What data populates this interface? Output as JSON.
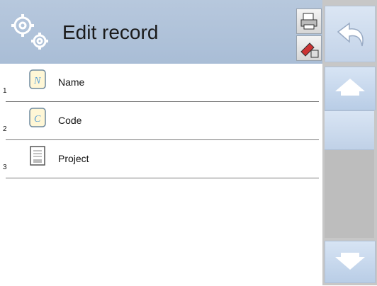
{
  "header": {
    "title": "Edit record",
    "gear_icon": "gears-icon",
    "print_icon": "printer-icon",
    "settings_icon": "settings-icon"
  },
  "nav": {
    "back_icon": "undo-arrow-icon",
    "up_icon": "arrow-up-icon",
    "down_icon": "arrow-down-icon"
  },
  "records": [
    {
      "number": "1",
      "label": "Name",
      "icon": "name-icon",
      "icon_letter": "N"
    },
    {
      "number": "2",
      "label": "Code",
      "icon": "code-icon",
      "icon_letter": "C"
    },
    {
      "number": "3",
      "label": "Project",
      "icon": "project-icon"
    }
  ],
  "colors": {
    "header_bg": "#b7c8dd",
    "nav_bg": "#c7c7c7",
    "accent": "#4a90d9"
  }
}
